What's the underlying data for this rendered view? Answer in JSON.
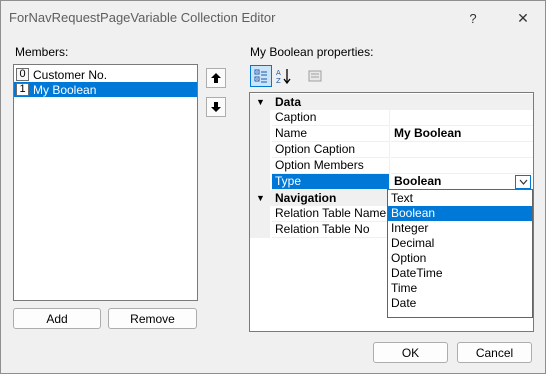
{
  "window": {
    "title": "ForNavRequestPageVariable Collection Editor",
    "help": "?",
    "close": "✕"
  },
  "members": {
    "label": "Members:",
    "items": [
      {
        "index": "0",
        "name": "Customer No."
      },
      {
        "index": "1",
        "name": "My Boolean"
      }
    ],
    "selected_index": 1,
    "add_label": "Add",
    "remove_label": "Remove",
    "move_up_icon": "arrow-up-icon",
    "move_down_icon": "arrow-down-icon"
  },
  "properties": {
    "label": "My Boolean properties:",
    "toolbar": [
      "categorized-icon",
      "alphabetical-icon",
      "property-pages-icon"
    ],
    "categories": [
      {
        "name": "Data",
        "toggle": "▼",
        "rows": [
          {
            "name": "Caption",
            "value": ""
          },
          {
            "name": "Name",
            "value": "My Boolean"
          },
          {
            "name": "Option Caption",
            "value": ""
          },
          {
            "name": "Option Members",
            "value": ""
          },
          {
            "name": "Type",
            "value": "Boolean"
          }
        ]
      },
      {
        "name": "Navigation",
        "toggle": "▼",
        "rows": [
          {
            "name": "Relation Table Name",
            "value": ""
          },
          {
            "name": "Relation Table No",
            "value": ""
          }
        ]
      }
    ],
    "type_dropdown": {
      "options": [
        "Text",
        "Boolean",
        "Integer",
        "Decimal",
        "Option",
        "DateTime",
        "Time",
        "Date"
      ],
      "selected": "Boolean"
    }
  },
  "footer": {
    "ok_label": "OK",
    "cancel_label": "Cancel"
  },
  "colors": {
    "selection": "#0078d7",
    "background": "#f0f0f0"
  }
}
